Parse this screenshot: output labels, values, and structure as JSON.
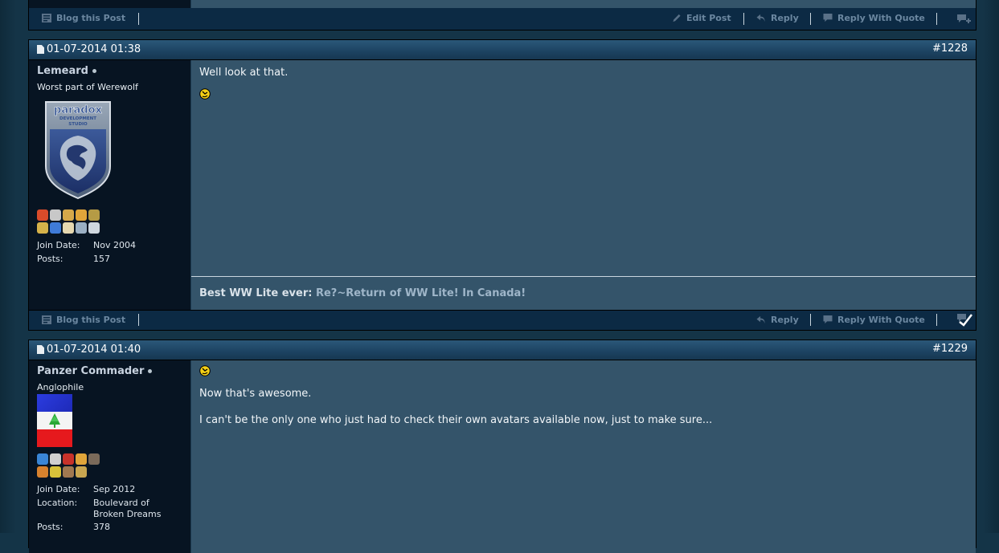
{
  "top_post": {
    "blog_label": "Blog this Post",
    "edit_label": "Edit Post",
    "reply_label": "Reply",
    "quote_label": "Reply With Quote"
  },
  "posts": [
    {
      "date": "01-07-2014 01:38",
      "number": "#1228",
      "username": "Lemeard",
      "usertitle": "Worst part of Werewolf",
      "avatar": "paradox-development-studio-logo",
      "join_date_label": "Join Date:",
      "join_date": "Nov 2004",
      "posts_label": "Posts:",
      "posts": "157",
      "message_line1": "Well look at that.",
      "sig_title": "Best WW Lite ever:",
      "sig_link": "Re?~Return of WW Lite! In Canada!",
      "blog_label": "Blog this Post",
      "reply_label": "Reply",
      "quote_label": "Reply With Quote"
    },
    {
      "date": "01-07-2014 01:40",
      "number": "#1229",
      "username": "Panzer Commader",
      "usertitle": "Anglophile",
      "avatar": "lebanon-flag-variant",
      "join_date_label": "Join Date:",
      "join_date": "Sep 2012",
      "location_label": "Location:",
      "location": "Boulevard of Broken Dreams",
      "posts_label": "Posts:",
      "posts": "378",
      "message_line1": "Now that's awesome.",
      "message_line2": "I can't be the only one who just had to check their own avatars available now, just to make sure..."
    }
  ]
}
